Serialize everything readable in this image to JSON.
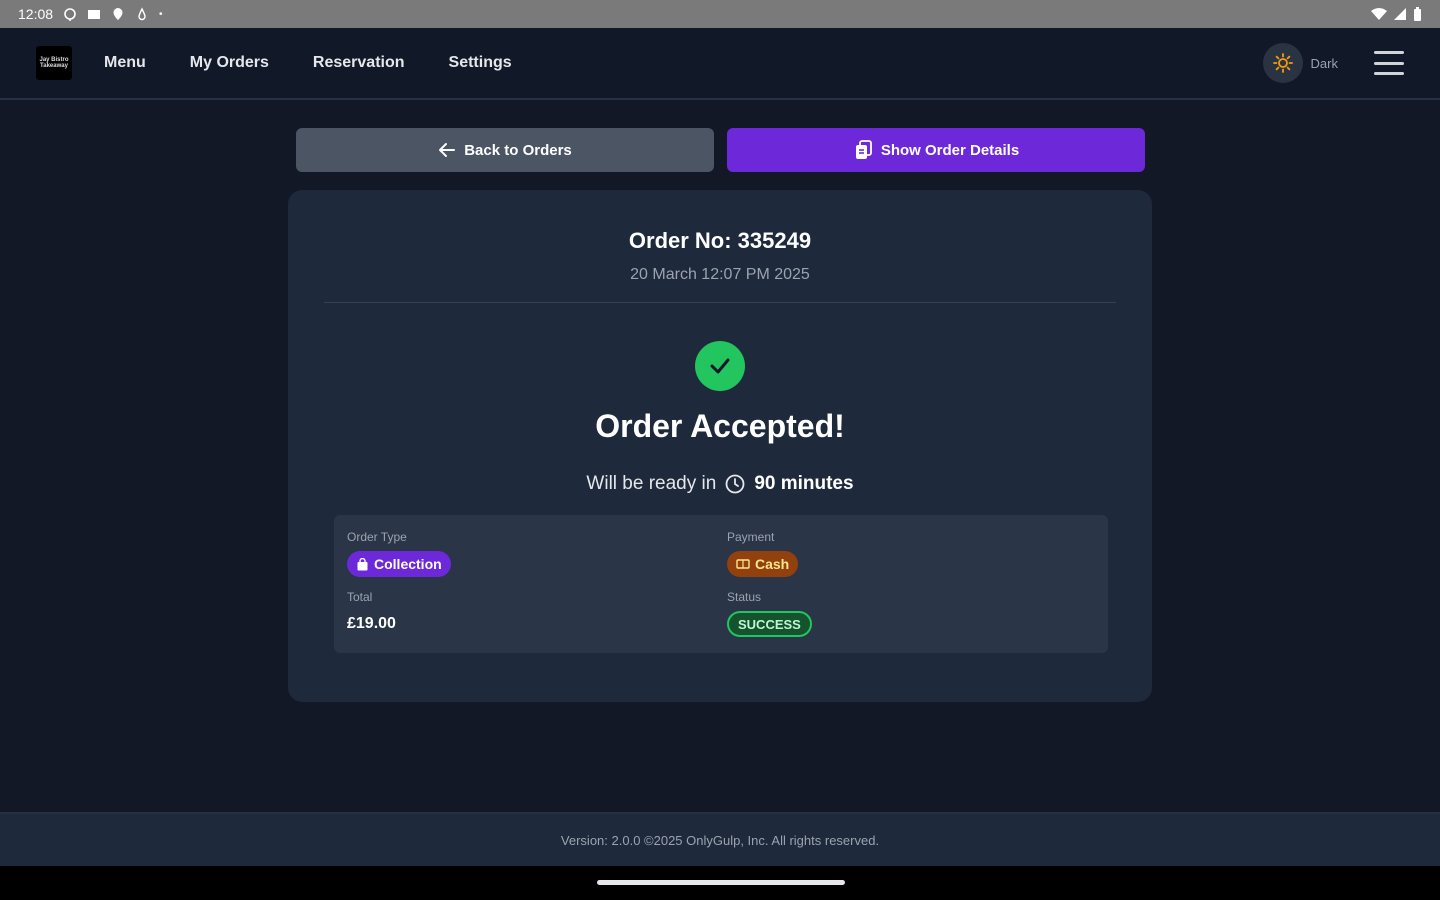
{
  "status_bar": {
    "time": "12:08",
    "dot": "•",
    "icons_left": [
      "shield-icon",
      "photo-icon",
      "location-icon",
      "drop-icon",
      "dot-icon"
    ],
    "icons_right": [
      "wifi-icon",
      "signal-icon",
      "battery-icon"
    ]
  },
  "nav": {
    "logo_text": "Jay Bistro Takeaway",
    "links": [
      "Menu",
      "My Orders",
      "Reservation",
      "Settings"
    ],
    "theme_label": "Dark",
    "theme_icon": "sun-icon",
    "menu_icon": "hamburger-icon"
  },
  "actions": {
    "back_label": "Back to Orders",
    "details_label": "Show Order Details",
    "details_color": "#6d28d9"
  },
  "order": {
    "number": "Order No: 335249",
    "date": "20 March 12:07 PM 2025",
    "status_title": "Order Accepted!",
    "ready_prefix": "Will be ready in",
    "ready_time": "90 minutes",
    "order_type_label": "Order Type",
    "order_type": "Collection",
    "payment_label": "Payment",
    "payment": "Cash",
    "total_label": "Total",
    "total": "£19.00",
    "status_label": "Status",
    "status": "SUCCESS"
  },
  "footer": {
    "text": "Version: 2.0.0 ©2025 OnlyGulp, Inc. All rights reserved."
  },
  "colors": {
    "background": "#121826",
    "card": "#1e293b",
    "accent": "#6d28d9",
    "success": "#22c55e"
  }
}
